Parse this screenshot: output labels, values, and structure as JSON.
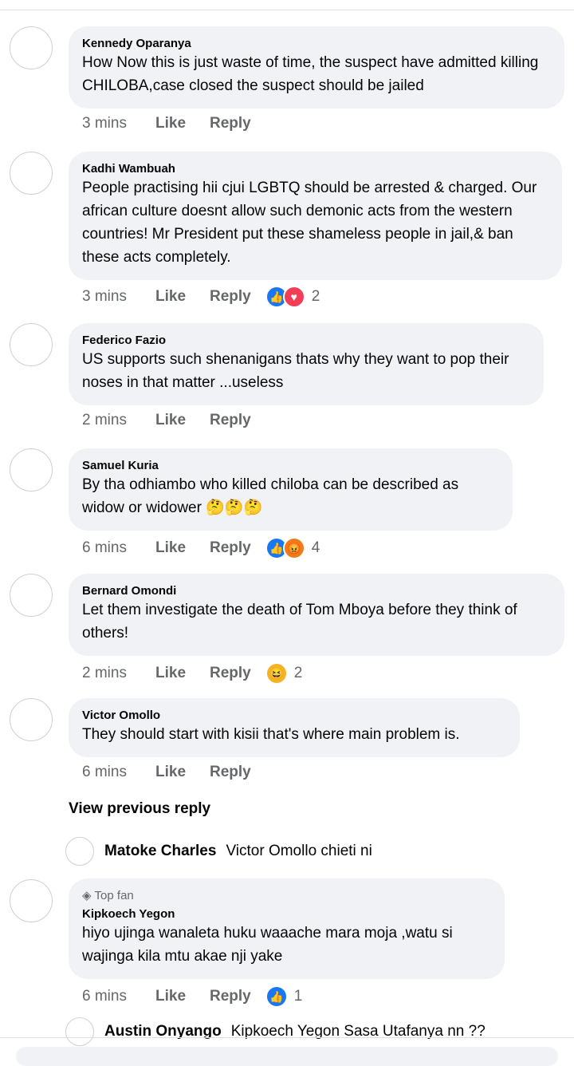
{
  "comments": [
    {
      "author": "Kennedy Oparanya",
      "text": "How Now this is just waste of time, the suspect have admitted killing CHILOBA,case closed the suspect should be jailed",
      "time": "3 mins",
      "like": "Like",
      "reply": "Reply"
    },
    {
      "author": "Kadhi Wambuah",
      "text": "People practising hii cjui LGBTQ should be arrested & charged. Our african culture doesnt allow such demonic acts from the western countries! Mr President put these shameless people in jail,& ban these acts completely.",
      "time": "3 mins",
      "like": "Like",
      "reply": "Reply",
      "reactions": [
        "like-icon",
        "love-icon"
      ],
      "reaction_count": "2"
    },
    {
      "author": "Federico Fazio",
      "text": "US supports  such shenanigans  thats why they want to pop their noses in that matter ...useless",
      "time": "2 mins",
      "like": "Like",
      "reply": "Reply"
    },
    {
      "author": "Samuel Kuria",
      "text": "By tha odhiambo who killed chiloba can be described as widow or widower 🤔🤔🤔",
      "time": "6 mins",
      "like": "Like",
      "reply": "Reply",
      "reactions": [
        "like-icon",
        "angry-icon"
      ],
      "reaction_count": "4"
    },
    {
      "author": "Bernard Omondi",
      "text": "Let them investigate the death of Tom Mboya before they think of others!",
      "time": "2 mins",
      "like": "Like",
      "reply": "Reply",
      "reactions": [
        "haha-icon"
      ],
      "reaction_count": "2"
    },
    {
      "author": "Victor Omollo",
      "text": "They should start with kisii that's where main problem is.",
      "time": "6 mins",
      "like": "Like",
      "reply": "Reply"
    },
    {
      "badge": "Top fan",
      "author": "Kipkoech Yegon",
      "text": "hiyo ujinga wanaleta huku waaache mara moja ,watu si wajinga kila mtu akae nji yake",
      "time": "6 mins",
      "like": "Like",
      "reply": "Reply",
      "reactions": [
        "like-icon"
      ],
      "reaction_count": "1"
    }
  ],
  "view_previous_reply": "View previous reply",
  "replies": [
    {
      "author": "Matoke Charles",
      "text": "Victor Omollo chieti ni"
    },
    {
      "author": "Austin Onyango",
      "text": "Kipkoech Yegon Sasa Utafanya nn ??"
    }
  ],
  "colors": {
    "bubble": "#f0f2f5",
    "secondary_text": "#65676b",
    "like_blue": "#1877f2",
    "love_red": "#f33e58"
  }
}
